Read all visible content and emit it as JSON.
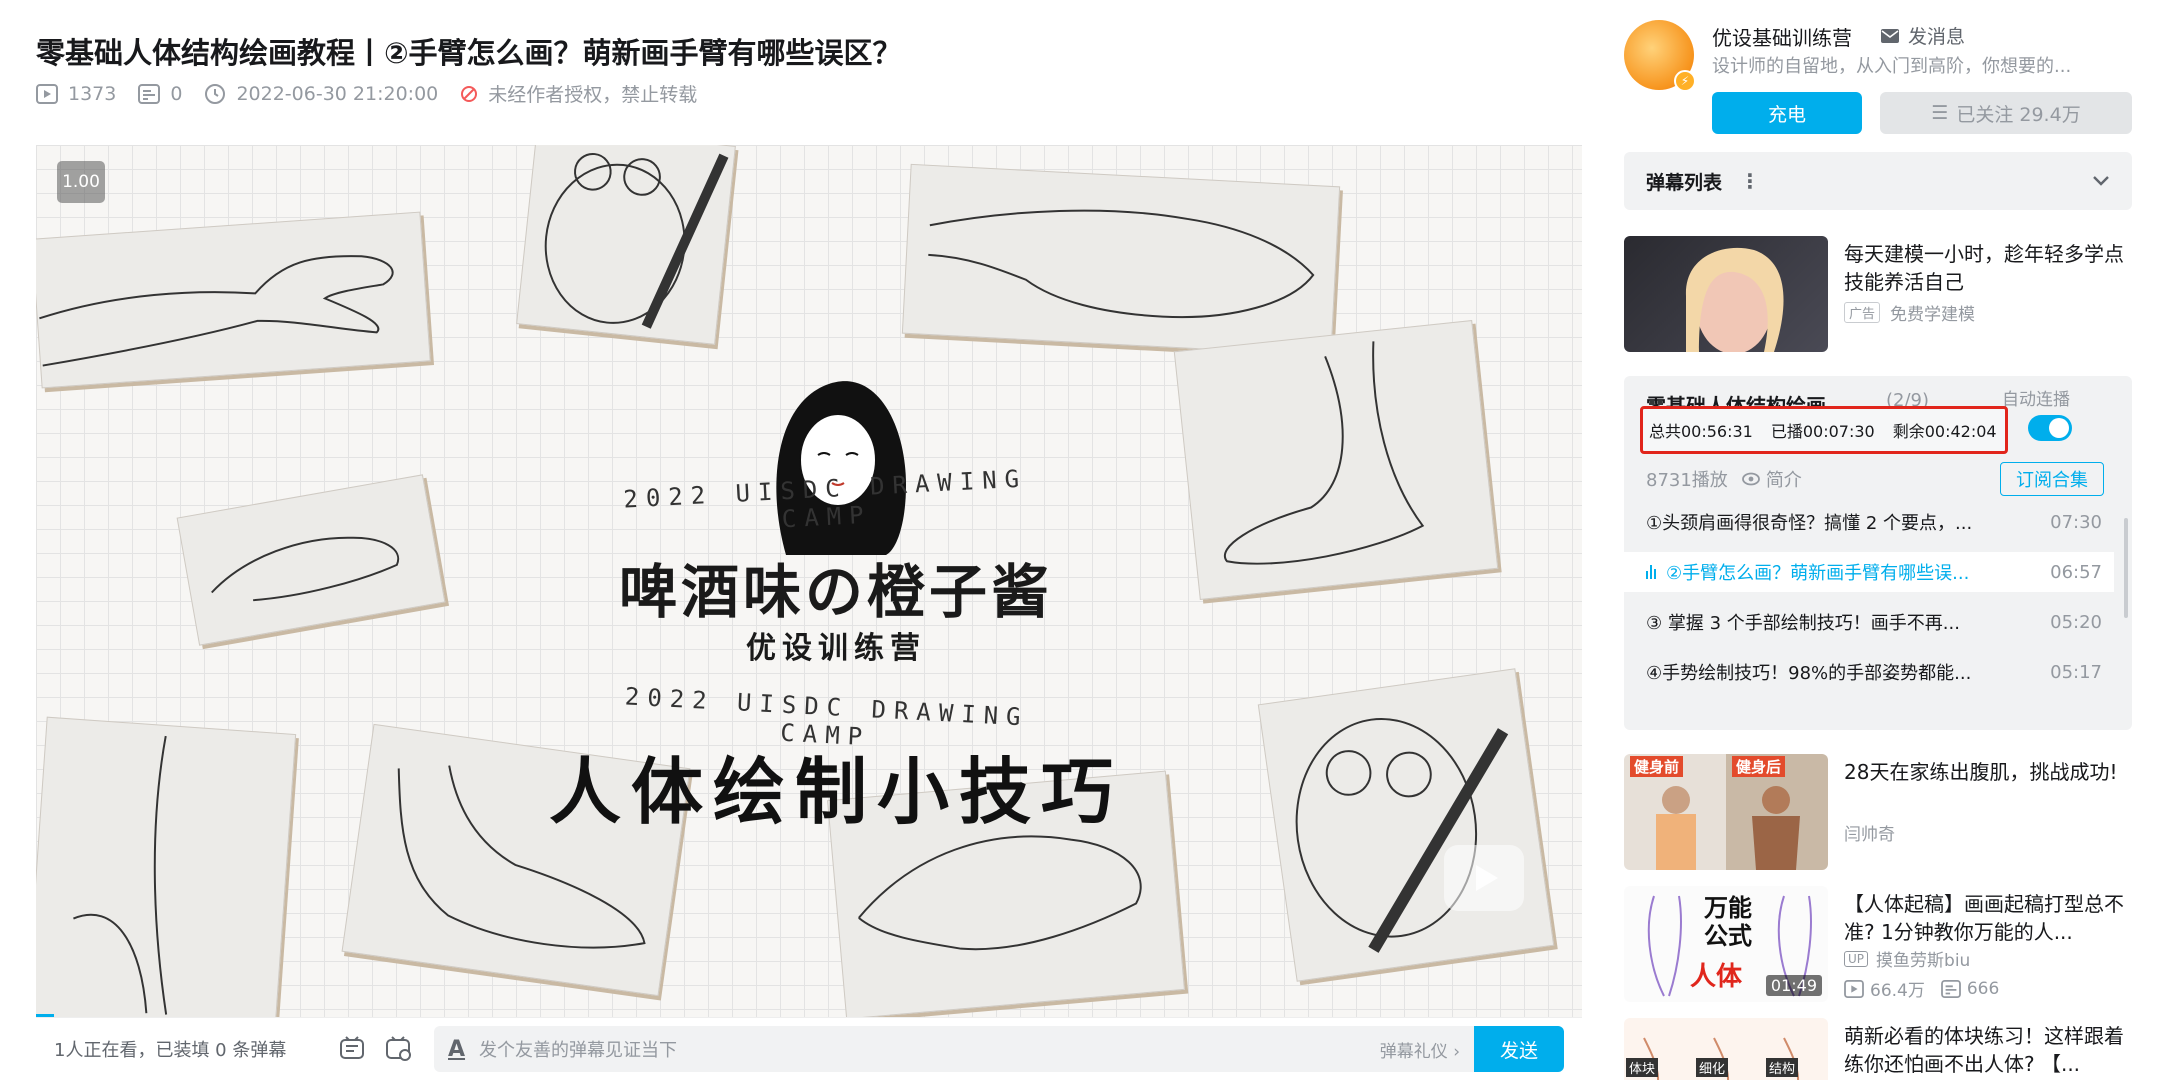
{
  "video": {
    "title": "零基础人体结构绘画教程丨②手臂怎么画？萌新画手臂有哪些误区？",
    "views": "1373",
    "danmaku_count": "0",
    "datetime": "2022-06-30 21:20:00",
    "copyright": "未经作者授权，禁止转载"
  },
  "player": {
    "speed": "1.00",
    "cover_text": {
      "title": "啤酒味の橙子酱",
      "subtitle": "优设训练营",
      "camp_top": "2022 UISDC DRAWING CAMP",
      "camp_bottom": "2022 UISDC DRAWING CAMP",
      "headline": "人体绘制小技巧"
    }
  },
  "danmaku_bar": {
    "viewers": "1人正在看，已装填 0 条弹幕",
    "input_placeholder": "发个友善的弹幕见证当下",
    "etiquette": "弹幕礼仪 ›",
    "send": "发送",
    "font_icon_label": "A"
  },
  "uploader": {
    "name": "优设基础训练营",
    "message": "发消息",
    "description": "设计师的自留地，从入门到高阶，你想要的...",
    "charge": "充电",
    "follow": "已关注 29.4万"
  },
  "danmaku_list": {
    "label": "弹幕列表"
  },
  "ad": {
    "title": "每天建模一小时，趁年轻多学点技能养活自己",
    "tag": "广告",
    "source": "免费学建模"
  },
  "collection": {
    "title": "零基础人体结构绘画...",
    "count": "(2/9)",
    "autoplay": "自动连播",
    "total": "总共00:56:31",
    "played": "已播00:07:30",
    "remaining": "剩余00:42:04",
    "plays": "8731播放",
    "intro": "简介",
    "subscribe": "订阅合集",
    "episodes": [
      {
        "title": "①头颈肩画得很奇怪？搞懂 2 个要点，...",
        "duration": "07:30",
        "active": false
      },
      {
        "title": "②手臂怎么画？萌新画手臂有哪些误...",
        "duration": "06:57",
        "active": true
      },
      {
        "title": "③ 掌握 3 个手部绘制技巧！画手不再...",
        "duration": "05:20",
        "active": false
      },
      {
        "title": "④手势绘制技巧！98%的手部姿势都能...",
        "duration": "05:17",
        "active": false
      }
    ]
  },
  "recommendations": [
    {
      "title": "28天在家练出腹肌，挑战成功!",
      "author": "闫帅奇",
      "thumb_labels": [
        "健身前",
        "健身后"
      ]
    },
    {
      "title": "【人体起稿】画画起稿打型总不准? 1分钟教你万能的人...",
      "author": "摸鱼劳斯biu",
      "views": "66.4万",
      "danmaku": "666",
      "duration": "01:49",
      "thumb_text": [
        "万能",
        "公式",
        "人体"
      ]
    },
    {
      "title": "萌新必看的体块练习！这样跟着练你还怕画不出人体? 【...",
      "thumb_labels": [
        "体块",
        "细化",
        "结构"
      ]
    }
  ],
  "colors": {
    "accent": "#00aeec",
    "highlight_border": "#e1251b",
    "text_primary": "#18191c",
    "text_secondary": "#9499a0"
  }
}
